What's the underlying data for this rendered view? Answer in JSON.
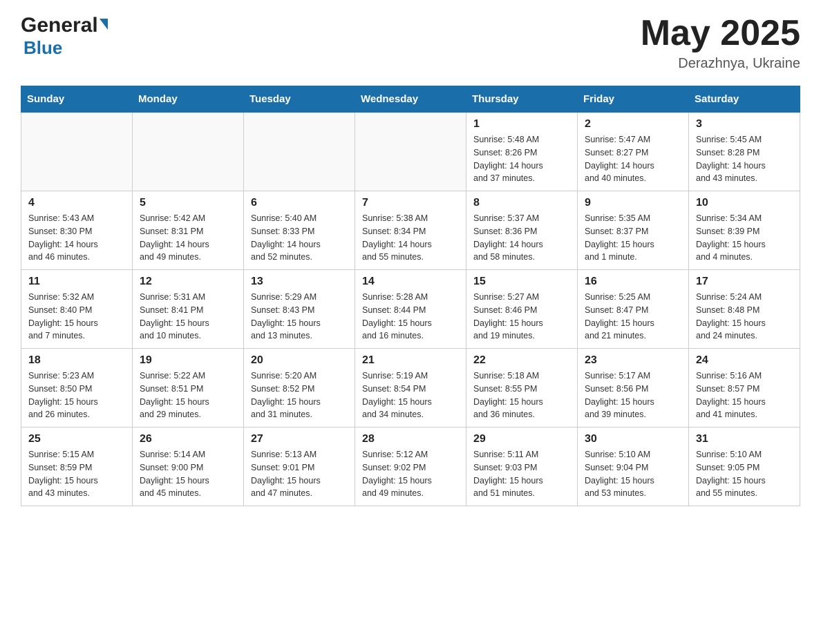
{
  "header": {
    "logo_general": "General",
    "logo_blue": "Blue",
    "month_year": "May 2025",
    "location": "Derazhnya, Ukraine"
  },
  "calendar": {
    "days_of_week": [
      "Sunday",
      "Monday",
      "Tuesday",
      "Wednesday",
      "Thursday",
      "Friday",
      "Saturday"
    ],
    "weeks": [
      {
        "cells": [
          {
            "day": "",
            "info": ""
          },
          {
            "day": "",
            "info": ""
          },
          {
            "day": "",
            "info": ""
          },
          {
            "day": "",
            "info": ""
          },
          {
            "day": "1",
            "info": "Sunrise: 5:48 AM\nSunset: 8:26 PM\nDaylight: 14 hours\nand 37 minutes."
          },
          {
            "day": "2",
            "info": "Sunrise: 5:47 AM\nSunset: 8:27 PM\nDaylight: 14 hours\nand 40 minutes."
          },
          {
            "day": "3",
            "info": "Sunrise: 5:45 AM\nSunset: 8:28 PM\nDaylight: 14 hours\nand 43 minutes."
          }
        ]
      },
      {
        "cells": [
          {
            "day": "4",
            "info": "Sunrise: 5:43 AM\nSunset: 8:30 PM\nDaylight: 14 hours\nand 46 minutes."
          },
          {
            "day": "5",
            "info": "Sunrise: 5:42 AM\nSunset: 8:31 PM\nDaylight: 14 hours\nand 49 minutes."
          },
          {
            "day": "6",
            "info": "Sunrise: 5:40 AM\nSunset: 8:33 PM\nDaylight: 14 hours\nand 52 minutes."
          },
          {
            "day": "7",
            "info": "Sunrise: 5:38 AM\nSunset: 8:34 PM\nDaylight: 14 hours\nand 55 minutes."
          },
          {
            "day": "8",
            "info": "Sunrise: 5:37 AM\nSunset: 8:36 PM\nDaylight: 14 hours\nand 58 minutes."
          },
          {
            "day": "9",
            "info": "Sunrise: 5:35 AM\nSunset: 8:37 PM\nDaylight: 15 hours\nand 1 minute."
          },
          {
            "day": "10",
            "info": "Sunrise: 5:34 AM\nSunset: 8:39 PM\nDaylight: 15 hours\nand 4 minutes."
          }
        ]
      },
      {
        "cells": [
          {
            "day": "11",
            "info": "Sunrise: 5:32 AM\nSunset: 8:40 PM\nDaylight: 15 hours\nand 7 minutes."
          },
          {
            "day": "12",
            "info": "Sunrise: 5:31 AM\nSunset: 8:41 PM\nDaylight: 15 hours\nand 10 minutes."
          },
          {
            "day": "13",
            "info": "Sunrise: 5:29 AM\nSunset: 8:43 PM\nDaylight: 15 hours\nand 13 minutes."
          },
          {
            "day": "14",
            "info": "Sunrise: 5:28 AM\nSunset: 8:44 PM\nDaylight: 15 hours\nand 16 minutes."
          },
          {
            "day": "15",
            "info": "Sunrise: 5:27 AM\nSunset: 8:46 PM\nDaylight: 15 hours\nand 19 minutes."
          },
          {
            "day": "16",
            "info": "Sunrise: 5:25 AM\nSunset: 8:47 PM\nDaylight: 15 hours\nand 21 minutes."
          },
          {
            "day": "17",
            "info": "Sunrise: 5:24 AM\nSunset: 8:48 PM\nDaylight: 15 hours\nand 24 minutes."
          }
        ]
      },
      {
        "cells": [
          {
            "day": "18",
            "info": "Sunrise: 5:23 AM\nSunset: 8:50 PM\nDaylight: 15 hours\nand 26 minutes."
          },
          {
            "day": "19",
            "info": "Sunrise: 5:22 AM\nSunset: 8:51 PM\nDaylight: 15 hours\nand 29 minutes."
          },
          {
            "day": "20",
            "info": "Sunrise: 5:20 AM\nSunset: 8:52 PM\nDaylight: 15 hours\nand 31 minutes."
          },
          {
            "day": "21",
            "info": "Sunrise: 5:19 AM\nSunset: 8:54 PM\nDaylight: 15 hours\nand 34 minutes."
          },
          {
            "day": "22",
            "info": "Sunrise: 5:18 AM\nSunset: 8:55 PM\nDaylight: 15 hours\nand 36 minutes."
          },
          {
            "day": "23",
            "info": "Sunrise: 5:17 AM\nSunset: 8:56 PM\nDaylight: 15 hours\nand 39 minutes."
          },
          {
            "day": "24",
            "info": "Sunrise: 5:16 AM\nSunset: 8:57 PM\nDaylight: 15 hours\nand 41 minutes."
          }
        ]
      },
      {
        "cells": [
          {
            "day": "25",
            "info": "Sunrise: 5:15 AM\nSunset: 8:59 PM\nDaylight: 15 hours\nand 43 minutes."
          },
          {
            "day": "26",
            "info": "Sunrise: 5:14 AM\nSunset: 9:00 PM\nDaylight: 15 hours\nand 45 minutes."
          },
          {
            "day": "27",
            "info": "Sunrise: 5:13 AM\nSunset: 9:01 PM\nDaylight: 15 hours\nand 47 minutes."
          },
          {
            "day": "28",
            "info": "Sunrise: 5:12 AM\nSunset: 9:02 PM\nDaylight: 15 hours\nand 49 minutes."
          },
          {
            "day": "29",
            "info": "Sunrise: 5:11 AM\nSunset: 9:03 PM\nDaylight: 15 hours\nand 51 minutes."
          },
          {
            "day": "30",
            "info": "Sunrise: 5:10 AM\nSunset: 9:04 PM\nDaylight: 15 hours\nand 53 minutes."
          },
          {
            "day": "31",
            "info": "Sunrise: 5:10 AM\nSunset: 9:05 PM\nDaylight: 15 hours\nand 55 minutes."
          }
        ]
      }
    ]
  }
}
